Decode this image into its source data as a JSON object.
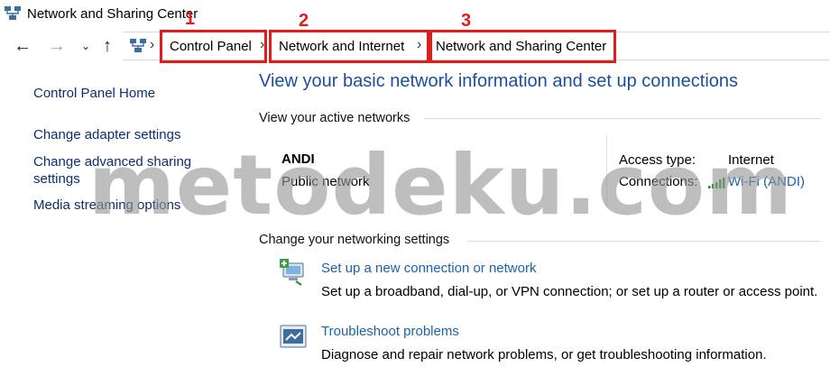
{
  "window": {
    "title": "Network and Sharing Center"
  },
  "nav": {
    "back_icon": "back-arrow-icon",
    "forward_icon": "forward-arrow-icon",
    "recent_icon": "chevron-down-icon",
    "up_icon": "up-arrow-icon"
  },
  "breadcrumb": {
    "items": [
      {
        "label": "Control Panel",
        "marker": "1"
      },
      {
        "label": "Network and Internet",
        "marker": "2"
      },
      {
        "label": "Network and Sharing Center",
        "marker": "3"
      }
    ],
    "separator": "›"
  },
  "sidebar": {
    "items": [
      {
        "label": "Control Panel Home"
      },
      {
        "label": "Change adapter settings"
      },
      {
        "label": "Change advanced sharing",
        "label_line2": "settings"
      },
      {
        "label": "Media streaming options"
      }
    ]
  },
  "main": {
    "heading": "View your basic network information and set up connections",
    "active_networks": {
      "title": "View your active networks",
      "network_name": "ANDI",
      "network_type": "Public network",
      "access_type_label": "Access type:",
      "access_type_value": "Internet",
      "connections_label": "Connections:",
      "connections_value": "Wi-Fi (ANDI)"
    },
    "settings": {
      "title": "Change your networking settings",
      "items": [
        {
          "link": "Set up a new connection or network",
          "description": "Set up a broadband, dial-up, or VPN connection; or set up a router or access point.",
          "icon": "new-connection-icon"
        },
        {
          "link": "Troubleshoot problems",
          "description": "Diagnose and repair network problems, or get troubleshooting information.",
          "icon": "troubleshoot-icon"
        }
      ]
    }
  },
  "watermark": "metodeku.com",
  "colors": {
    "annotation_red": "#e21b1b",
    "link_blue": "#1b63a8",
    "heading_blue": "#1b4f9c"
  }
}
